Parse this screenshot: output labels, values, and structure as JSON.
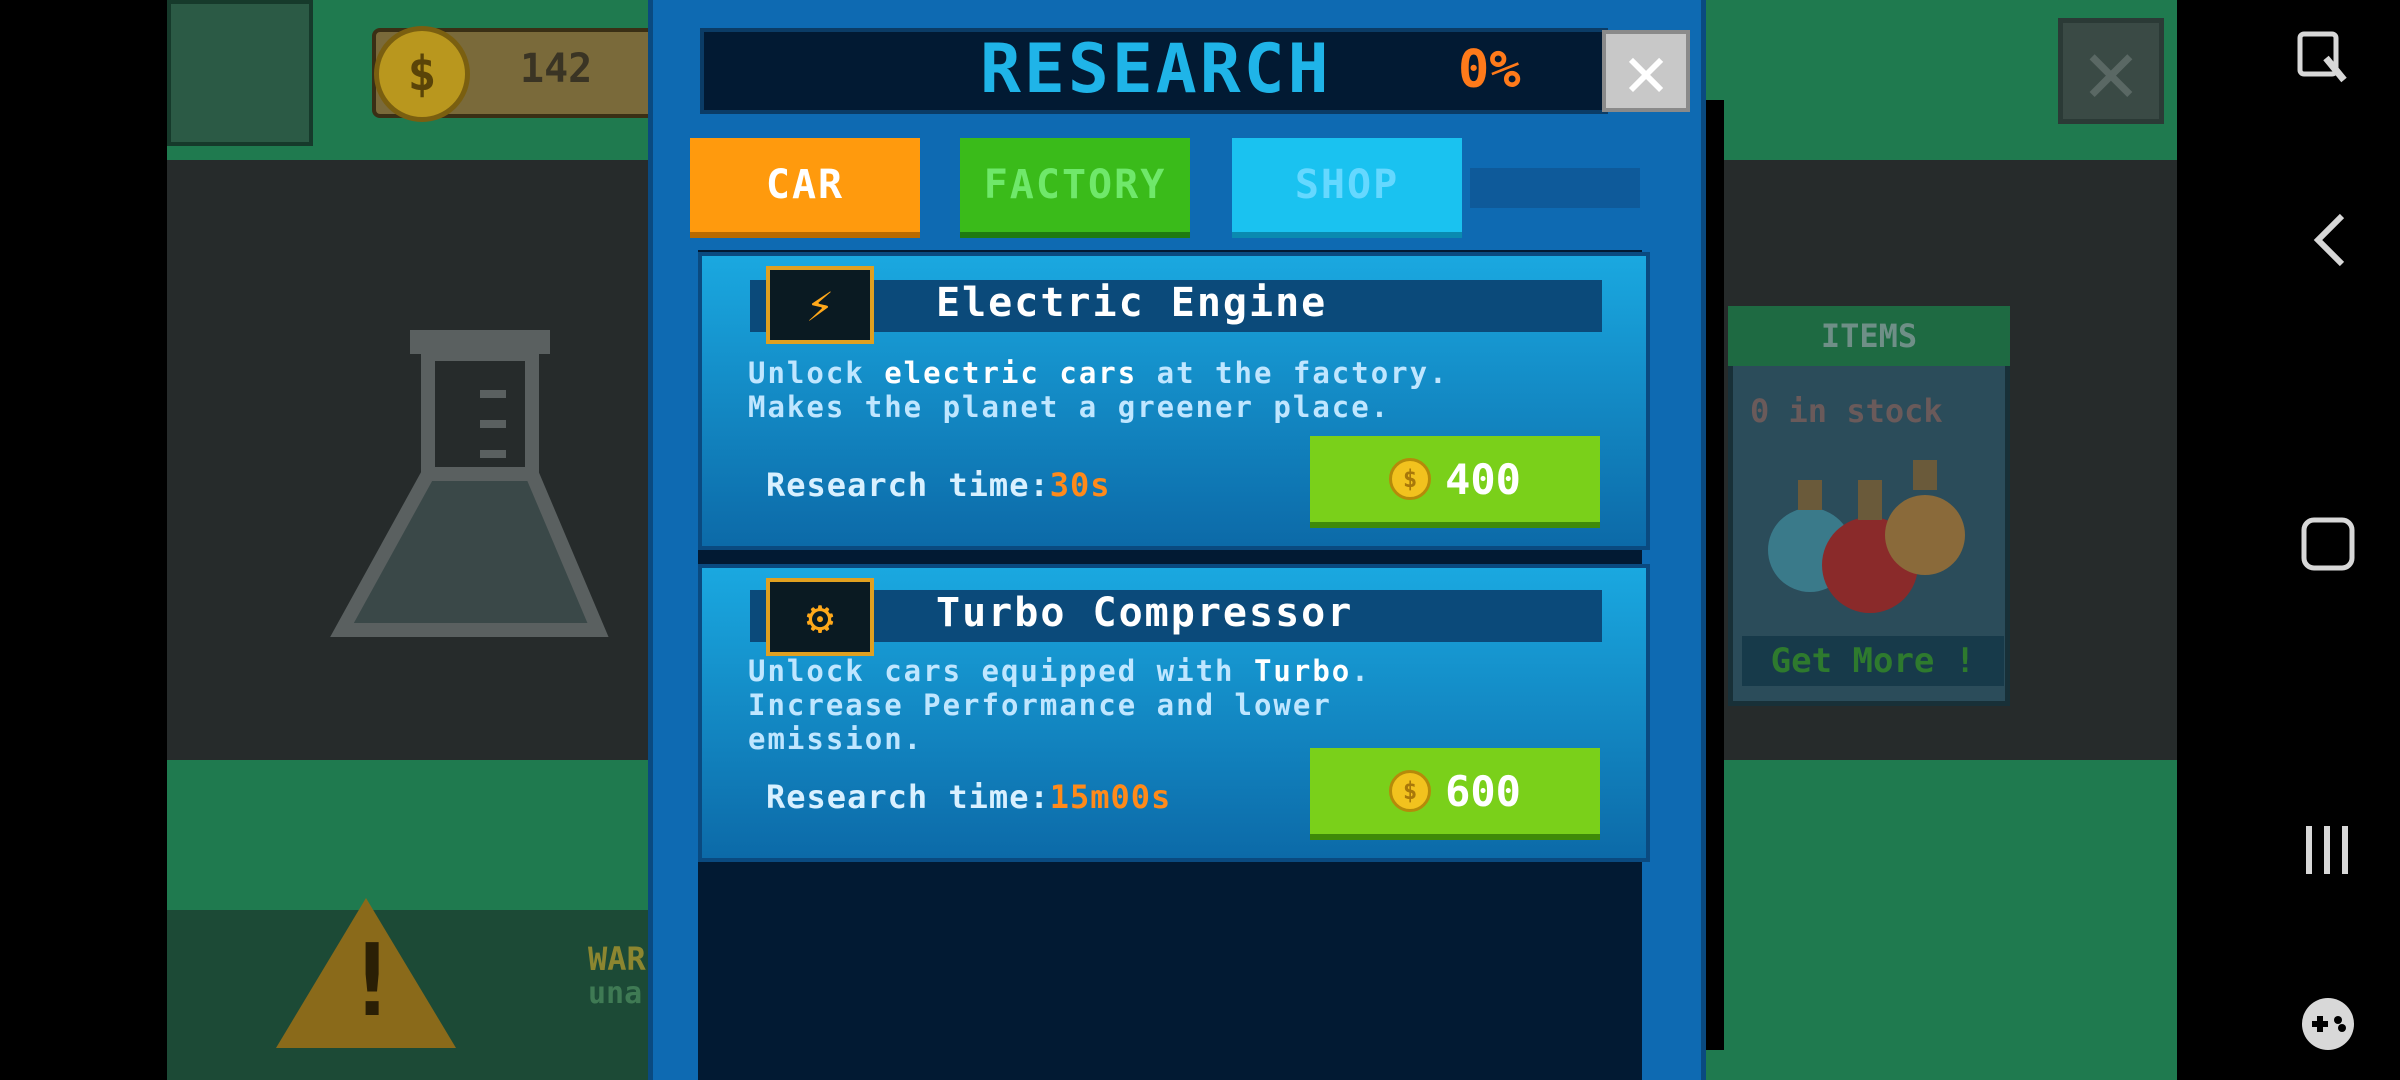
{
  "hud": {
    "coins": "142"
  },
  "background": {
    "items_panel": {
      "title": "ITEMS",
      "stock": "0 in stock",
      "get_more": "Get More !"
    },
    "warning": {
      "line1": "WAR",
      "line2": "una"
    }
  },
  "research": {
    "title": "RESEARCH",
    "progress": "0%",
    "tabs": [
      {
        "label": "CAR",
        "active": true
      },
      {
        "label": "FACTORY",
        "active": false
      },
      {
        "label": "SHOP",
        "active": false
      }
    ],
    "items": [
      {
        "icon": "electric-engine-icon",
        "title": "Electric Engine",
        "desc_pre": "Unlock ",
        "desc_hl": "electric cars",
        "desc_post": " at the factory.",
        "desc_line2": "Makes the planet a greener place.",
        "research_time_label": "Research time:",
        "research_time": "30s",
        "price": "400"
      },
      {
        "icon": "engine-icon",
        "title": "Turbo Compressor",
        "desc_pre": "Unlock cars equipped with ",
        "desc_hl": "Turbo",
        "desc_post": ".",
        "desc_line2": "Increase Performance and lower",
        "desc_line3": "emission.",
        "research_time_label": "Research time:",
        "research_time": "15m00s",
        "price": "600"
      }
    ]
  },
  "colors": {
    "accent_orange": "#ff9a0d",
    "accent_green": "#7ad01a",
    "panel_blue": "#0e6ab2",
    "title_cyan": "#1fb4e8"
  }
}
